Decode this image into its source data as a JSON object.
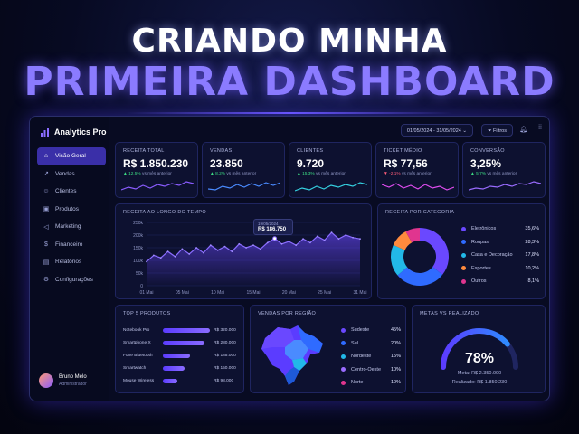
{
  "headline": {
    "line1": "CRIANDO MINHA",
    "line2": "PRIMEIRA DASHBOARD"
  },
  "brand": {
    "name": "Analytics Pro"
  },
  "sidebar": {
    "items": [
      {
        "label": "Visão Geral",
        "icon": "home-icon",
        "active": true
      },
      {
        "label": "Vendas",
        "icon": "trend-icon"
      },
      {
        "label": "Clientes",
        "icon": "users-icon"
      },
      {
        "label": "Produtos",
        "icon": "box-icon"
      },
      {
        "label": "Marketing",
        "icon": "megaphone-icon"
      },
      {
        "label": "Financeiro",
        "icon": "dollar-icon"
      },
      {
        "label": "Relatórios",
        "icon": "document-icon"
      },
      {
        "label": "Configurações",
        "icon": "gear-icon"
      }
    ]
  },
  "user": {
    "name": "Bruno Melo",
    "role": "Administrador"
  },
  "topbar": {
    "date_range": "01/05/2024 - 31/05/2024",
    "filter_label": "Filtros"
  },
  "kpis": [
    {
      "title": "RECEITA TOTAL",
      "value": "R$ 1.850.230",
      "delta": "12,5%",
      "dir": "up",
      "suffix": "vs mês anterior",
      "color": "#8a5cff"
    },
    {
      "title": "VENDAS",
      "value": "23.850",
      "delta": "8,2%",
      "dir": "up",
      "suffix": "vs mês anterior",
      "color": "#4a8bff"
    },
    {
      "title": "CLIENTES",
      "value": "9.720",
      "delta": "15,3%",
      "dir": "up",
      "suffix": "vs mês anterior",
      "color": "#35d0e0"
    },
    {
      "title": "TICKET MÉDIO",
      "value": "R$ 77,56",
      "delta": "-2,1%",
      "dir": "down",
      "suffix": "vs mês anterior",
      "color": "#e04cf0"
    },
    {
      "title": "CONVERSÃO",
      "value": "3,25%",
      "delta": "5,7%",
      "dir": "up",
      "suffix": "vs mês anterior",
      "color": "#9a6cff"
    }
  ],
  "revenue_chart": {
    "title": "RECEITA AO LONGO DO TEMPO",
    "tooltip": {
      "date": "19/05/2024",
      "value": "R$ 186.750"
    },
    "y_ticks": [
      "250k",
      "200k",
      "150k",
      "100k",
      "50k",
      "0"
    ],
    "x_ticks": [
      "01 Mai",
      "05 Mai",
      "10 Mai",
      "15 Mai",
      "20 Mai",
      "25 Mai",
      "31 Mai"
    ]
  },
  "chart_data": {
    "type": "area",
    "title": "RECEITA AO LONGO DO TEMPO",
    "xlabel": "",
    "ylabel": "",
    "ylim": [
      0,
      250000
    ],
    "x": [
      1,
      2,
      3,
      4,
      5,
      6,
      7,
      8,
      9,
      10,
      11,
      12,
      13,
      14,
      15,
      16,
      17,
      18,
      19,
      20,
      21,
      22,
      23,
      24,
      25,
      26,
      27,
      28,
      29,
      30,
      31
    ],
    "values": [
      95000,
      120000,
      110000,
      135000,
      115000,
      145000,
      125000,
      150000,
      130000,
      160000,
      140000,
      155000,
      135000,
      165000,
      150000,
      160000,
      145000,
      170000,
      186750,
      165000,
      175000,
      160000,
      185000,
      170000,
      195000,
      180000,
      210000,
      185000,
      200000,
      190000,
      185000
    ]
  },
  "category_chart": {
    "title": "RECEITA POR CATEGORIA",
    "items": [
      {
        "label": "Eletrônicos",
        "pct": "35,6%",
        "value": 35.6,
        "color": "#6a48ff"
      },
      {
        "label": "Roupas",
        "pct": "28,3%",
        "value": 28.3,
        "color": "#2f6bff"
      },
      {
        "label": "Casa e Decoração",
        "pct": "17,8%",
        "value": 17.8,
        "color": "#22b8e8"
      },
      {
        "label": "Esportes",
        "pct": "10,2%",
        "value": 10.2,
        "color": "#ff8a3d"
      },
      {
        "label": "Outros",
        "pct": "8,1%",
        "value": 8.1,
        "color": "#e0358f"
      }
    ]
  },
  "top_products": {
    "title": "TOP 5 PRODUTOS",
    "items": [
      {
        "name": "Notebook Pro",
        "value": "R$ 320.000",
        "amount": 320000
      },
      {
        "name": "Smartphone X",
        "value": "R$ 280.000",
        "amount": 280000
      },
      {
        "name": "Fone Bluetooth",
        "value": "R$ 185.000",
        "amount": 185000
      },
      {
        "name": "Smartwatch",
        "value": "R$ 150.000",
        "amount": 150000
      },
      {
        "name": "Mouse Wireless",
        "value": "R$ 98.000",
        "amount": 98000
      }
    ]
  },
  "region_sales": {
    "title": "VENDAS POR REGIÃO",
    "items": [
      {
        "label": "Sudeste",
        "pct": "45%",
        "color": "#6a48ff"
      },
      {
        "label": "Sul",
        "pct": "20%",
        "color": "#2f6bff"
      },
      {
        "label": "Nordeste",
        "pct": "15%",
        "color": "#22b8e8"
      },
      {
        "label": "Centro-Oeste",
        "pct": "10%",
        "color": "#9a6cff"
      },
      {
        "label": "Norte",
        "pct": "10%",
        "color": "#e0358f"
      }
    ]
  },
  "goals": {
    "title": "METAS VS REALIZADO",
    "percent": "78%",
    "progress": 0.78,
    "goal": "Meta: R$ 2.350.000",
    "realized": "Realizado: R$ 1.850.230"
  }
}
